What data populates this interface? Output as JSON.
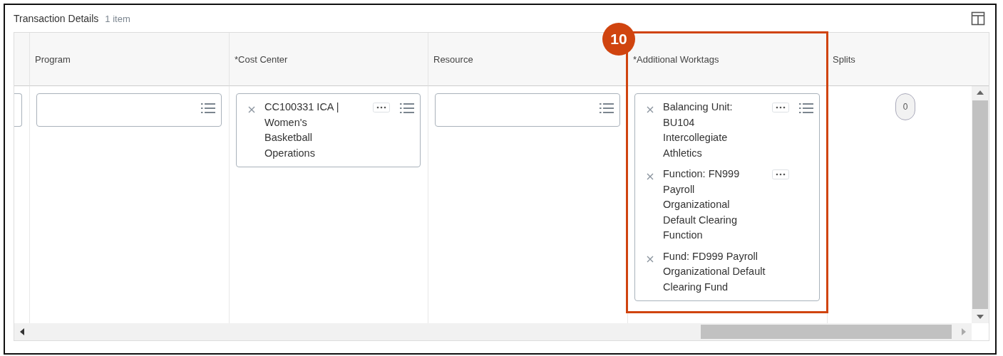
{
  "section": {
    "title": "Transaction Details",
    "count": "1 item"
  },
  "columns": [
    {
      "header": "Program",
      "kind": "field"
    },
    {
      "header": "*Cost Center",
      "kind": "field",
      "items": [
        {
          "text": "CC100331 ICA | Women's Basketball Operations",
          "more_button": true
        }
      ]
    },
    {
      "header": "Resource",
      "kind": "field"
    },
    {
      "header": "*Additional Worktags",
      "kind": "field",
      "items": [
        {
          "text": "Balancing Unit: BU104 Intercollegiate Athletics",
          "more_button": true
        },
        {
          "text": "Function: FN999 Payroll Organizational Default Clearing Function",
          "more_button": true
        },
        {
          "text": "Fund: FD999 Payroll Organizational Default Clearing Fund",
          "more_button": false
        }
      ]
    },
    {
      "header": "Splits",
      "kind": "count",
      "value": "0"
    }
  ],
  "annotation": {
    "number": "10"
  }
}
